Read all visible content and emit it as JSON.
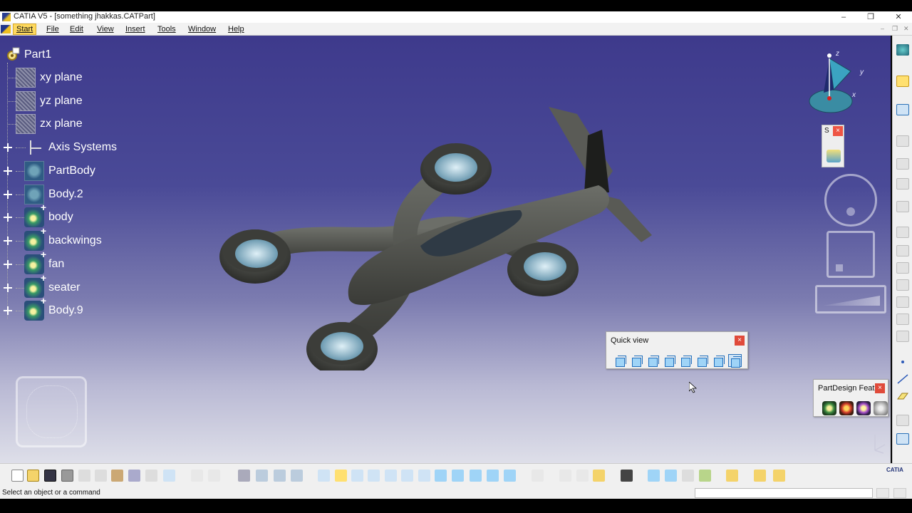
{
  "window": {
    "title": "CATIA V5 - [something jhakkas.CATPart]",
    "minimize": "–",
    "restore": "❐",
    "close": "✕"
  },
  "menu": {
    "items": [
      "Start",
      "File",
      "Edit",
      "View",
      "Insert",
      "Tools",
      "Window",
      "Help"
    ],
    "active": "Start"
  },
  "tree": {
    "root": "Part1",
    "items": [
      {
        "label": "xy plane",
        "icon": "plane-icon",
        "expandable": false
      },
      {
        "label": "yz plane",
        "icon": "plane-icon",
        "expandable": false
      },
      {
        "label": "zx plane",
        "icon": "plane-icon",
        "expandable": false
      },
      {
        "label": "Axis Systems",
        "icon": "axis-system-icon",
        "expandable": true
      },
      {
        "label": "PartBody",
        "icon": "body-icon",
        "expandable": true
      },
      {
        "label": "Body.2",
        "icon": "body-icon",
        "expandable": true
      },
      {
        "label": "body",
        "icon": "gear-body-icon",
        "expandable": true
      },
      {
        "label": "backwings",
        "icon": "gear-body-icon",
        "expandable": true
      },
      {
        "label": "fan",
        "icon": "gear-body-icon",
        "expandable": true
      },
      {
        "label": "seater",
        "icon": "gear-body-icon",
        "expandable": true
      },
      {
        "label": "Body.9",
        "icon": "gear-body-icon",
        "expandable": true
      }
    ]
  },
  "axis_compass": {
    "x": "x",
    "y": "y",
    "z": "z"
  },
  "mini_toolbar": {
    "title": "S",
    "close": "×"
  },
  "quick_view": {
    "title": "Quick view",
    "close": "×",
    "buttons": [
      "isometric-view",
      "front-view",
      "back-view",
      "left-view",
      "right-view",
      "top-view",
      "bottom-view",
      "named-views"
    ]
  },
  "partdesign": {
    "title": "PartDesign Featu...",
    "close": "×",
    "buttons": [
      "pad-feature",
      "pocket-feature",
      "shaft-feature",
      "hole-feature"
    ]
  },
  "status": {
    "message": "Select an object or a command"
  },
  "brand": "CATIA",
  "colors": {
    "viewport_top": "#3e3a8c",
    "viewport_bottom": "#dedfe9",
    "model": "#5b5d58",
    "active_menu": "#fdd95f"
  }
}
